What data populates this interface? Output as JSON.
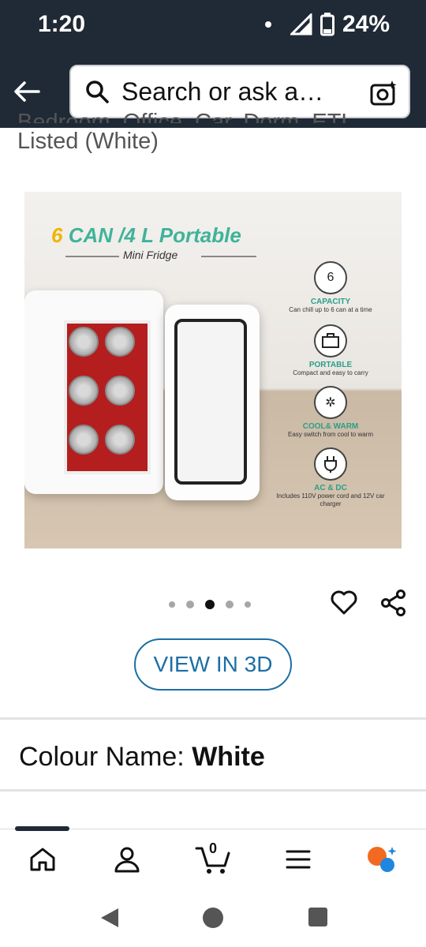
{
  "status_bar": {
    "time": "1:20",
    "battery": "24%"
  },
  "header": {
    "search_placeholder": "Search or ask a…"
  },
  "product": {
    "title_cut": "Bedroom, Office, Car, Dorm, ETL",
    "title_line2": "Listed (White)",
    "image": {
      "headline_num": "6",
      "headline_rest": " CAN /4 L Portable",
      "subtitle": "Mini Fridge",
      "features": [
        {
          "icon": "can-6-icon",
          "glyph": "6",
          "title": "CAPACITY",
          "desc": "Can chill up to 6 can at a time"
        },
        {
          "icon": "briefcase-icon",
          "glyph": "",
          "title": "PORTABLE",
          "desc": "Compact and easy to carry"
        },
        {
          "icon": "sun-snow-icon",
          "glyph": "",
          "title": "COOL& WARM",
          "desc": "Easy switch from cool to warm"
        },
        {
          "icon": "plug-icon",
          "glyph": "",
          "title": "AC & DC",
          "desc": "Includes 110V power cord and 12V car charger"
        }
      ]
    },
    "view3d_label": "VIEW IN 3D",
    "colour_label": "Colour Name: ",
    "colour_value": "White"
  },
  "tabbar": {
    "cart_count": "0"
  },
  "colors": {
    "header_bg": "#1f2a36",
    "accent_blue": "#1d6fa5",
    "teal": "#3fb39a"
  }
}
